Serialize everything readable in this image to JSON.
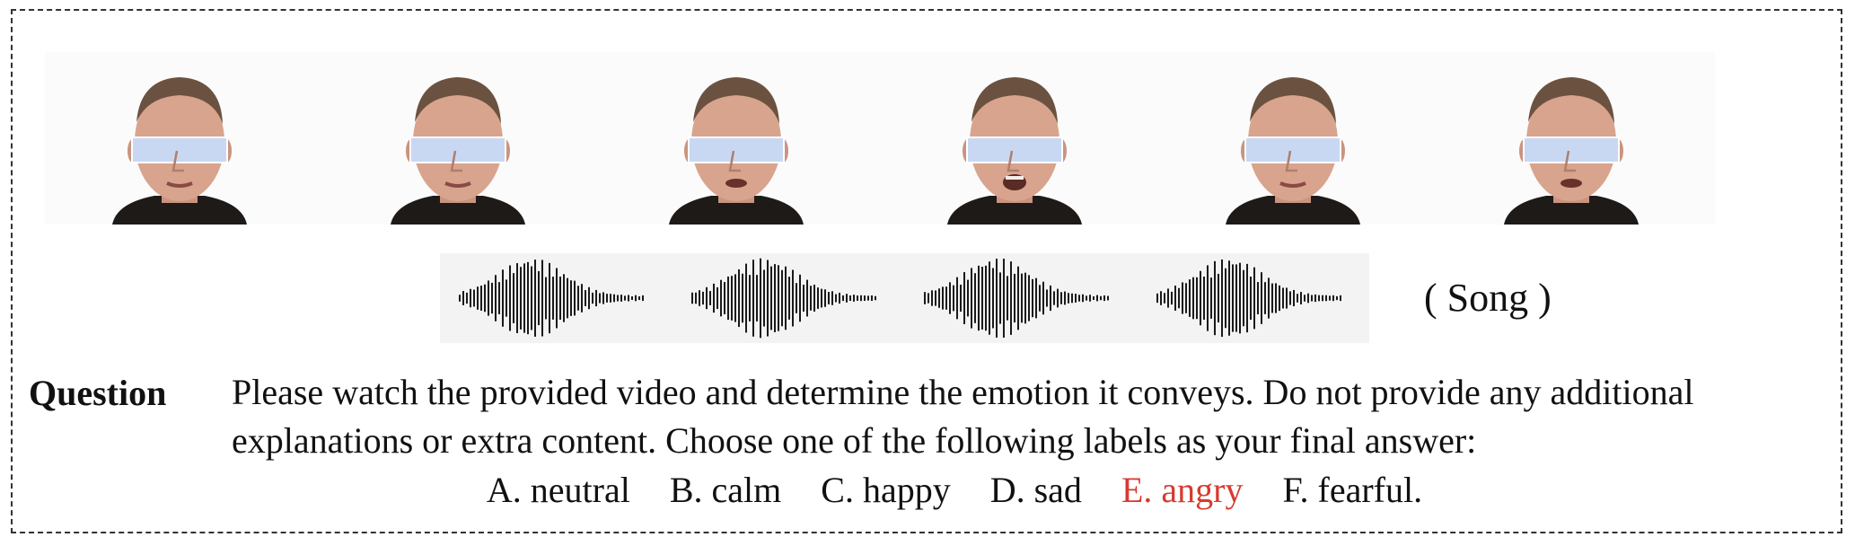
{
  "frames": [
    {
      "name": "video-frame-1",
      "mouth": "closed"
    },
    {
      "name": "video-frame-2",
      "mouth": "closed"
    },
    {
      "name": "video-frame-3",
      "mouth": "open"
    },
    {
      "name": "video-frame-4",
      "mouth": "wide"
    },
    {
      "name": "video-frame-5",
      "mouth": "closed"
    },
    {
      "name": "video-frame-6",
      "mouth": "open"
    }
  ],
  "audio_clips": 4,
  "audio_type_label": "( Song )",
  "question": {
    "label": "Question",
    "text": "Please watch the provided video and determine the emotion it conveys. Do not provide any additional explanations or extra content. Choose one of the following labels as your final answer:"
  },
  "options": {
    "a": "A. neutral",
    "b": "B. calm",
    "c": "C. happy",
    "d": "D. sad",
    "e": "E. angry",
    "f": "F. fearful."
  },
  "colors": {
    "answer_highlight": "#d63b2f",
    "eye_mask": "#c9d8f2",
    "skin": "#d8a48e",
    "shirt": "#1e1a18"
  }
}
